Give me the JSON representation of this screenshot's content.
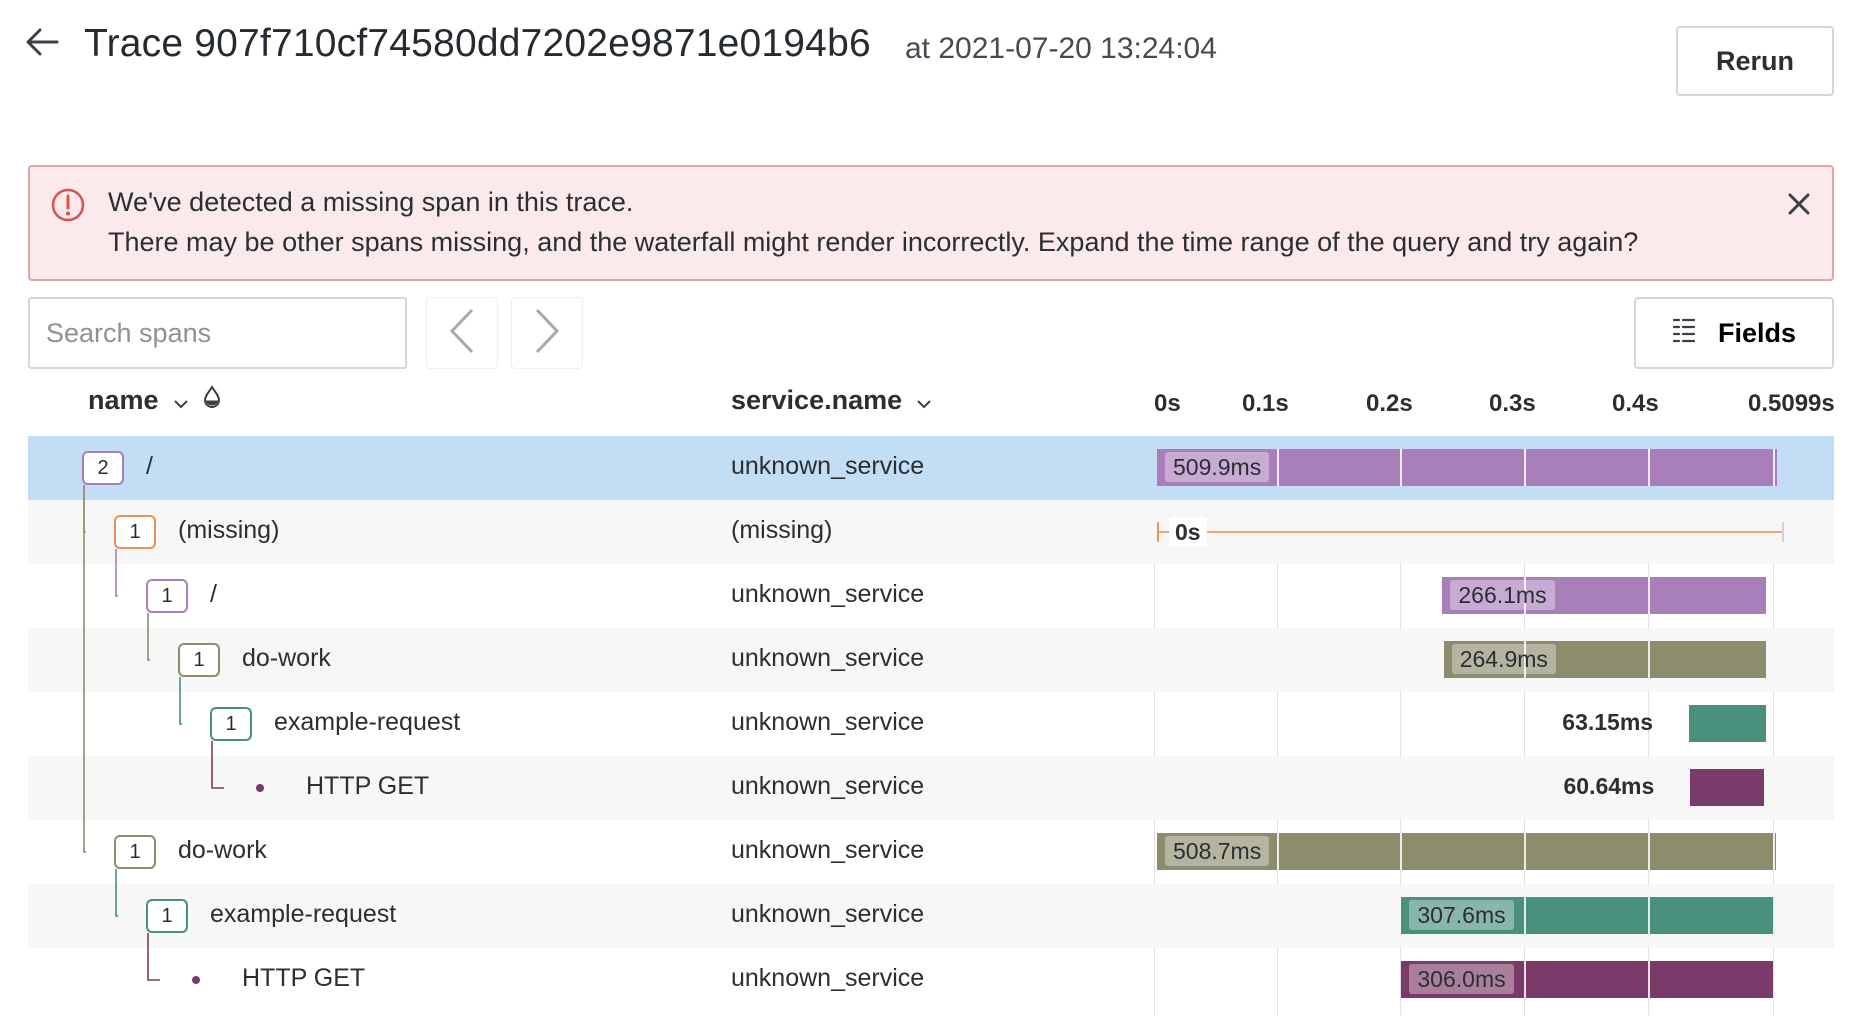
{
  "header": {
    "title": "Trace 907f710cf74580dd7202e9871e0194b6",
    "subtitle": "at 2021-07-20 13:24:04",
    "rerun_label": "Rerun"
  },
  "alert": {
    "line1": "We've detected a missing span in this trace.",
    "line2": "There may be other spans missing, and the waterfall might render incorrectly. Expand the time range of the query and try again?",
    "icon": "alert-circle-icon"
  },
  "toolbar": {
    "search_placeholder": "Search spans",
    "prev_icon": "chevron-left-icon",
    "next_icon": "chevron-right-icon",
    "fields_label": "Fields"
  },
  "columns": {
    "name": "name",
    "service": "service.name"
  },
  "timeline": {
    "ticks": [
      "0s",
      "0.1s",
      "0.2s",
      "0.3s",
      "0.4s",
      "0.5099s"
    ],
    "total_ms": 509.9
  },
  "colors": {
    "purple": "#a97fba",
    "olive": "#8d8d6d",
    "teal": "#49907e",
    "plum": "#7b3b68",
    "orange": "#e7945c",
    "selected_row": "#c3ddf4",
    "alert_bg": "#faeaeb"
  },
  "spans": [
    {
      "count": "2",
      "name": "/",
      "service": "unknown_service",
      "duration": "509.9ms",
      "start_ms": 0,
      "dur_ms": 509.9,
      "color": "#a97fba",
      "selected": true
    },
    {
      "count": "1",
      "name": "(missing)",
      "service": "(missing)",
      "duration": "0s",
      "start_ms": 0,
      "dur_ms": 0,
      "color": "#e7945c",
      "missing": true
    },
    {
      "count": "1",
      "name": "/",
      "service": "unknown_service",
      "duration": "266.1ms",
      "start_ms": 234.7,
      "dur_ms": 266.1,
      "color": "#a97fba"
    },
    {
      "count": "1",
      "name": "do-work",
      "service": "unknown_service",
      "duration": "264.9ms",
      "start_ms": 235.8,
      "dur_ms": 264.9,
      "color": "#8d8d6d"
    },
    {
      "count": "1",
      "name": "example-request",
      "service": "unknown_service",
      "duration": "63.15ms",
      "start_ms": 437.6,
      "dur_ms": 63.15,
      "color": "#49907e"
    },
    {
      "name": "HTTP GET",
      "service": "unknown_service",
      "duration": "60.64ms",
      "start_ms": 438.6,
      "dur_ms": 60.64,
      "color": "#7b3b68"
    },
    {
      "count": "1",
      "name": "do-work",
      "service": "unknown_service",
      "duration": "508.7ms",
      "start_ms": 0,
      "dur_ms": 508.7,
      "color": "#8d8d6d"
    },
    {
      "count": "1",
      "name": "example-request",
      "service": "unknown_service",
      "duration": "307.6ms",
      "start_ms": 201.0,
      "dur_ms": 307.6,
      "color": "#49907e"
    },
    {
      "name": "HTTP GET",
      "service": "unknown_service",
      "duration": "306.0ms",
      "start_ms": 201.0,
      "dur_ms": 306.0,
      "color": "#7b3b68"
    }
  ]
}
